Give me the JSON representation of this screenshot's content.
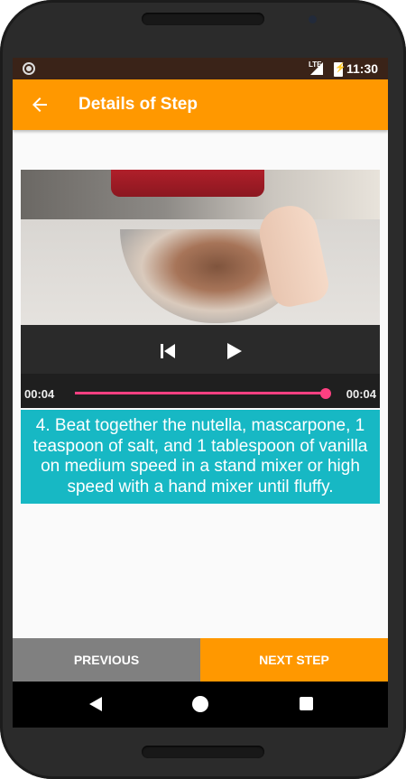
{
  "status_bar": {
    "network_label": "LTE",
    "time": "11:30",
    "notification_icon": "circle-icon",
    "battery_icon": "battery-charging-icon"
  },
  "toolbar": {
    "back_icon": "arrow-back-icon",
    "title": "Details of Step",
    "background": "#ff9800"
  },
  "player": {
    "position_time": "00:04",
    "duration_time": "00:04",
    "progress_fraction": 1.0,
    "accent": "#ff4081",
    "controls": [
      "previous-icon",
      "play-icon"
    ]
  },
  "step": {
    "description": "4. Beat together the nutella, mascarpone, 1 teaspoon of salt, and 1 tablespoon of vanilla on medium speed in a stand mixer or high speed with a hand mixer until fluffy.",
    "background": "#17b8c4"
  },
  "footer": {
    "previous_label": "PREVIOUS",
    "next_label": "NEXT STEP"
  },
  "nav_bar": {
    "icons": [
      "nav-back-icon",
      "nav-home-icon",
      "nav-recents-icon"
    ]
  }
}
